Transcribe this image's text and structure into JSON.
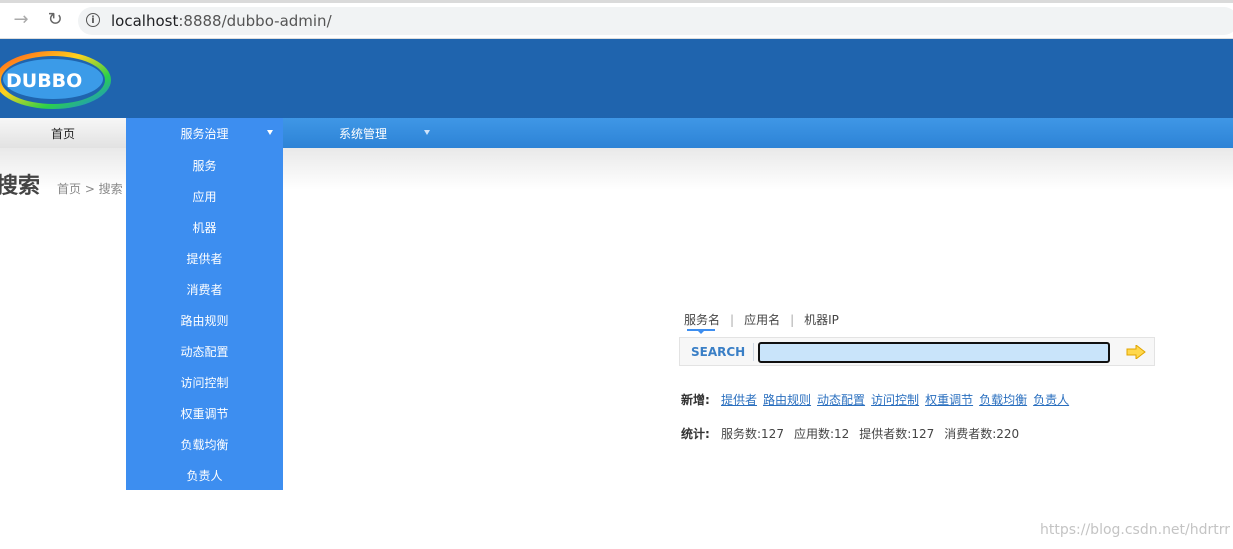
{
  "browser": {
    "url_host": "localhost",
    "url_rest": ":8888/dubbo-admin/",
    "icons": {
      "back": "arrow-right-icon",
      "reload": "reload-icon",
      "info": "info-icon"
    }
  },
  "logo": {
    "text": "DUBBO"
  },
  "nav": {
    "home": "首页",
    "service_gov": "服务治理",
    "system_mgmt": "系统管理"
  },
  "page": {
    "title": "搜索",
    "breadcrumb": "首页 > 搜索"
  },
  "dropdown": {
    "items": [
      "服务",
      "应用",
      "机器",
      "提供者",
      "消费者",
      "路由规则",
      "动态配置",
      "访问控制",
      "权重调节",
      "负载均衡",
      "负责人"
    ]
  },
  "search": {
    "tabs": [
      "服务名",
      "应用名",
      "机器IP"
    ],
    "label": "SEARCH",
    "value": ""
  },
  "add": {
    "label": "新增:",
    "links": [
      "提供者",
      "路由规则",
      "动态配置",
      "访问控制",
      "权重调节",
      "负载均衡",
      "负责人"
    ]
  },
  "stats": {
    "label": "统计:",
    "items": [
      "服务数:127",
      "应用数:12",
      "提供者数:127",
      "消费者数:220"
    ]
  },
  "watermark": "https://blog.csdn.net/hdrtrr",
  "colors": {
    "banner": "#1f64ae",
    "nav": "#3d8ef0",
    "link": "#2a6fbf"
  }
}
